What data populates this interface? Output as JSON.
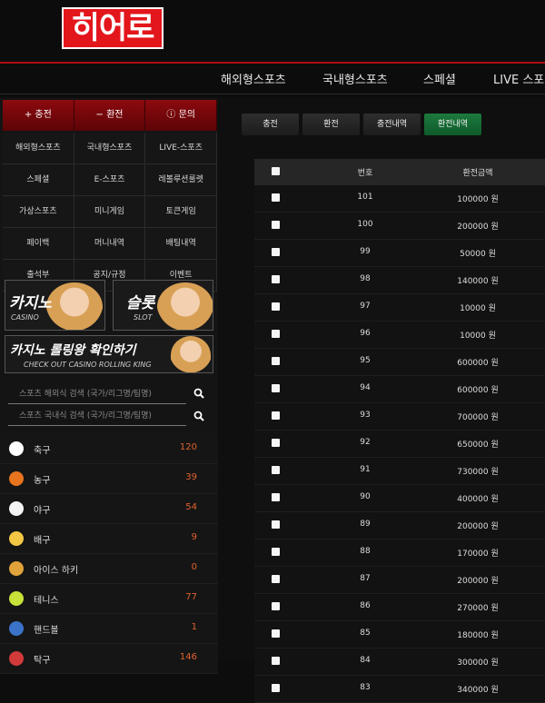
{
  "brand": {
    "logo_text": "히어로"
  },
  "nav": {
    "items": [
      "해외형스포츠",
      "국내형스포츠",
      "스페셜",
      "LIVE 스포츠"
    ]
  },
  "sidebar": {
    "top_buttons": [
      {
        "icon": "plus-icon",
        "label": "충전"
      },
      {
        "icon": "minus-icon",
        "label": "환전"
      },
      {
        "icon": "info-icon",
        "label": "문의"
      }
    ],
    "menu": [
      [
        "해외형스포츠",
        "국내형스포츠",
        "LIVE-스포츠"
      ],
      [
        "스페셜",
        "E-스포츠",
        "레볼루션룰렛"
      ],
      [
        "가상스포츠",
        "미니게임",
        "토큰게임"
      ],
      [
        "페이백",
        "머니내역",
        "배팅내역"
      ],
      [
        "출석부",
        "공지/규정",
        "이벤트"
      ]
    ],
    "banners": {
      "casino": {
        "big": "카지노",
        "small": "CASINO"
      },
      "slot": {
        "big": "슬롯",
        "small": "SLOT"
      },
      "rolling": {
        "big": "카지노 롤링왕 확인하기",
        "small": "CHECK OUT CASINO ROLLING KING"
      }
    },
    "search": {
      "overseas_placeholder": "스포츠 해외식 검색 (국가/리그명/팀명)",
      "domestic_placeholder": "스포츠 국내식 검색 (국가/리그명/팀명)"
    },
    "sports": [
      {
        "name": "축구",
        "count": "120",
        "icon": "soccer-ball-icon",
        "color": "#ffffff"
      },
      {
        "name": "농구",
        "count": "39",
        "icon": "basketball-icon",
        "color": "#e8741e"
      },
      {
        "name": "야구",
        "count": "54",
        "icon": "baseball-icon",
        "color": "#f4f4f4"
      },
      {
        "name": "배구",
        "count": "9",
        "icon": "volleyball-icon",
        "color": "#f2c744"
      },
      {
        "name": "아이스 하키",
        "count": "0",
        "icon": "hockey-stick-icon",
        "color": "#e0a23a"
      },
      {
        "name": "테니스",
        "count": "77",
        "icon": "tennis-ball-icon",
        "color": "#c8e23a"
      },
      {
        "name": "핸드볼",
        "count": "1",
        "icon": "handball-icon",
        "color": "#3a73c8"
      },
      {
        "name": "탁구",
        "count": "146",
        "icon": "table-tennis-icon",
        "color": "#d23a3a"
      }
    ]
  },
  "main": {
    "tabs": [
      "충전",
      "환전",
      "충전내역",
      "환전내역"
    ],
    "active_tab": "환전내역",
    "table": {
      "headers": [
        "번호",
        "환전금액"
      ],
      "rows": [
        {
          "no": "101",
          "amount": "100000 원"
        },
        {
          "no": "100",
          "amount": "200000 원"
        },
        {
          "no": "99",
          "amount": "50000 원"
        },
        {
          "no": "98",
          "amount": "140000 원"
        },
        {
          "no": "97",
          "amount": "10000 원"
        },
        {
          "no": "96",
          "amount": "10000 원"
        },
        {
          "no": "95",
          "amount": "600000 원"
        },
        {
          "no": "94",
          "amount": "600000 원"
        },
        {
          "no": "93",
          "amount": "700000 원"
        },
        {
          "no": "92",
          "amount": "650000 원"
        },
        {
          "no": "91",
          "amount": "730000 원"
        },
        {
          "no": "90",
          "amount": "400000 원"
        },
        {
          "no": "89",
          "amount": "200000 원"
        },
        {
          "no": "88",
          "amount": "170000 원"
        },
        {
          "no": "87",
          "amount": "200000 원"
        },
        {
          "no": "86",
          "amount": "270000 원"
        },
        {
          "no": "85",
          "amount": "180000 원"
        },
        {
          "no": "84",
          "amount": "300000 원"
        },
        {
          "no": "83",
          "amount": "340000 원"
        }
      ]
    }
  },
  "colors": {
    "brand_red": "#e3161c",
    "accent_line": "#b10e14",
    "active_tab": "#1d7a3e",
    "count": "#e0622e"
  }
}
